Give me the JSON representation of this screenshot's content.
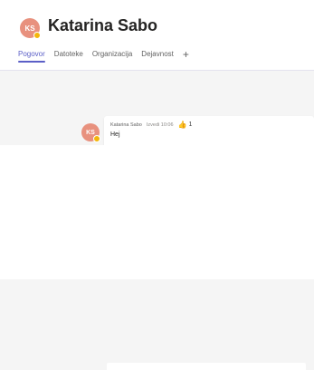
{
  "chat": {
    "avatar_initials": "KS",
    "title": "Katarina Sabo",
    "tabs": [
      {
        "label": "Pogovor",
        "active": true
      },
      {
        "label": "Datoteke",
        "active": false
      },
      {
        "label": "Organizacija",
        "active": false
      },
      {
        "label": "Dejavnost",
        "active": false
      }
    ],
    "add_tab_label": "+"
  },
  "message": {
    "avatar_initials": "KS",
    "author": "Katarina Sabo",
    "time": "Izvedi 10:06",
    "reaction_count": "1",
    "text": "Hej"
  },
  "colors": {
    "accent": "#5b5fc7",
    "avatar": "#e8917e",
    "presence": "#f3b60c",
    "background": "#f5f5f5"
  }
}
